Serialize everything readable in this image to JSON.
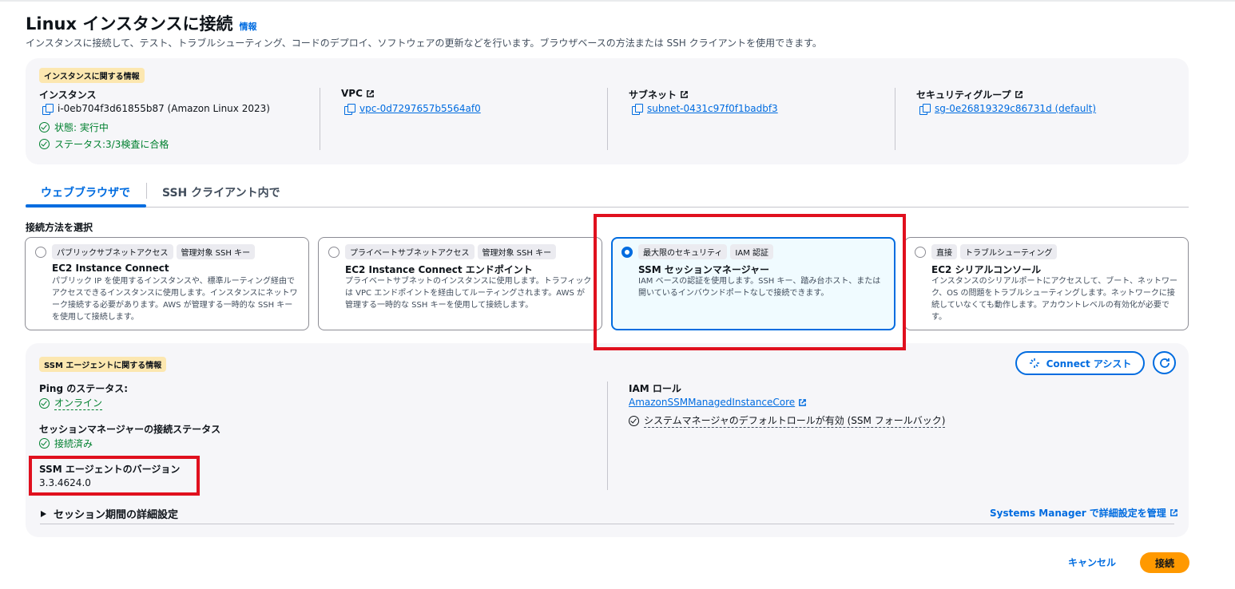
{
  "header": {
    "title": "Linux インスタンスに接続",
    "info_link": "情報",
    "description": "インスタンスに接続して、テスト、トラブルシューティング、コードのデプロイ、ソフトウェアの更新などを行います。ブラウザベースの方法または SSH クライアントを使用できます。"
  },
  "instance_info": {
    "badge": "インスタンスに関する情報",
    "instance_label": "インスタンス",
    "instance_id": "i-0eb704f3d61855b87 (Amazon Linux 2023)",
    "state": "状態: 実行中",
    "status": "ステータス:3/3検査に合格",
    "vpc_label": "VPC",
    "vpc_value": "vpc-0d7297657b5564af0",
    "subnet_label": "サブネット",
    "subnet_value": "subnet-0431c97f0f1badbf3",
    "sg_label": "セキュリティグループ",
    "sg_value": "sg-0e26819329c86731d (default)"
  },
  "tabs": [
    {
      "label": "ウェブブラウザで",
      "active": true
    },
    {
      "label": "SSH クライアント内で",
      "active": false
    }
  ],
  "method_label": "接続方法を選択",
  "options": [
    {
      "tags": [
        "パブリックサブネットアクセス",
        "管理対象 SSH キー"
      ],
      "title": "EC2 Instance Connect",
      "description": "パブリック IP を使用するインスタンスや、標準ルーティング経由でアクセスできるインスタンスに使用します。インスタンスにネットワーク接続する必要があります。AWS が管理する一時的な SSH キーを使用して接続します。",
      "selected": false
    },
    {
      "tags": [
        "プライベートサブネットアクセス",
        "管理対象 SSH キー"
      ],
      "title": "EC2 Instance Connect エンドポイント",
      "description": "プライベートサブネットのインスタンスに使用します。トラフィックは VPC エンドポイントを経由してルーティングされます。AWS が管理する一時的な SSH キーを使用して接続します。",
      "selected": false
    },
    {
      "tags": [
        "最大限のセキュリティ",
        "IAM 認証"
      ],
      "title": "SSM セッションマネージャー",
      "description": "IAM ベースの認証を使用します。SSH キー、踏み台ホスト、または開いているインバウンドポートなしで接続できます。",
      "selected": true
    },
    {
      "tags": [
        "直接",
        "トラブルシューティング"
      ],
      "title": "EC2 シリアルコンソール",
      "description": "インスタンスのシリアルポートにアクセスして、ブート、ネットワーク、OS の問題をトラブルシューティングします。ネットワークに接続していなくても動作します。アカウントレベルの有効化が必要です。",
      "selected": false
    }
  ],
  "ssm": {
    "badge": "SSM エージェントに関する情報",
    "ping_label": "Ping のステータス:",
    "ping_value": "オンライン",
    "session_label": "セッションマネージャーの接続ステータス",
    "session_value": "接続済み",
    "version_label": "SSM エージェントのバージョン",
    "version_value": "3.3.4624.0",
    "iam_label": "IAM ロール",
    "iam_value": "AmazonSSMManagedInstanceCore",
    "default_role": "システムマネージャのデフォルトロールが有効 (SSM フォールバック)",
    "connect_assist": "Connect アシスト",
    "session_expander": "セッション期間の詳細設定",
    "manage_link": "Systems Manager で詳細設定を管理"
  },
  "footer": {
    "cancel": "キャンセル",
    "connect": "接続"
  },
  "colors": {
    "accent": "#006ce0",
    "primary_button": "#ff9900",
    "success": "#00802f",
    "highlight_box": "#e0101e",
    "badge": "#fce7b0"
  }
}
